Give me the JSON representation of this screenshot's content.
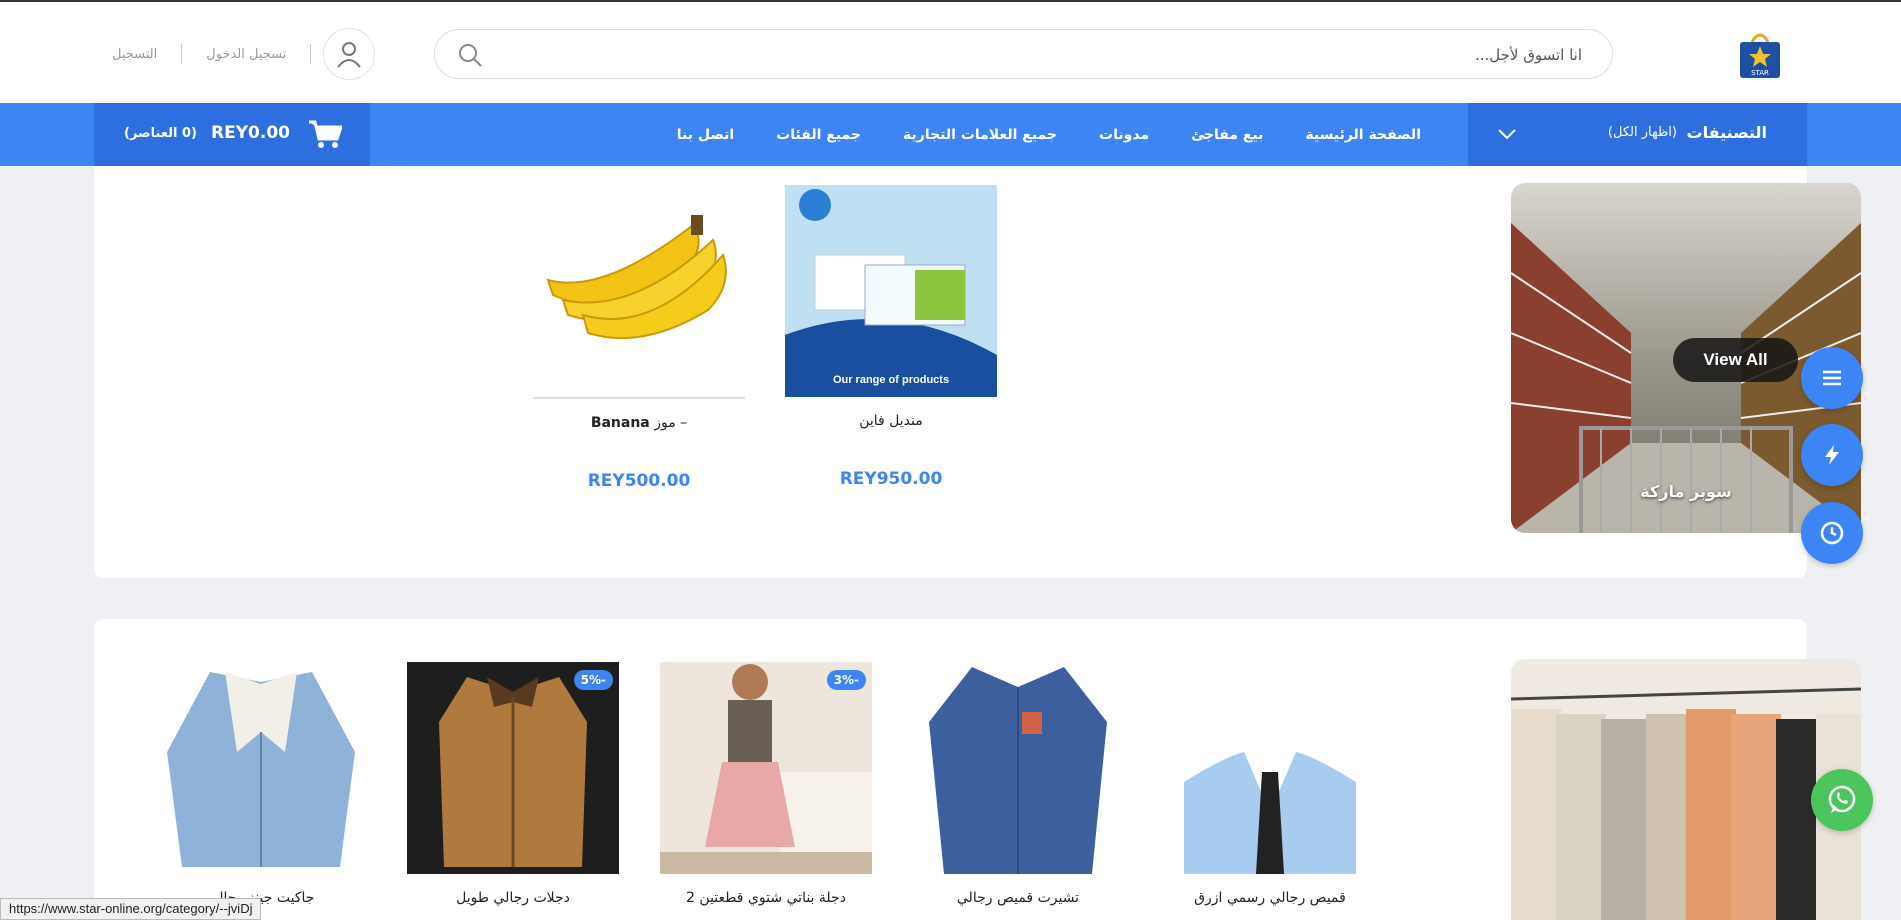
{
  "header": {
    "search_placeholder": "انا اتسوق لأجل...",
    "login_label": "تسجيل الدخول",
    "register_label": "التسجيل"
  },
  "nav": {
    "categories_title": "التصنيفات",
    "show_all": "(اظهار الكل)",
    "links": [
      "الصفحة الرئيسية",
      "بيع مفاجئ",
      "مدونات",
      "جميع العلامات التجارية",
      "جميع الفئات",
      "اتصل بنا"
    ],
    "cart_total": "REY0.00",
    "cart_items": "(0 العناصر)"
  },
  "section1": {
    "banner_title": "سوبر ماركة",
    "view_all": "View All",
    "products": [
      {
        "name": "منديل فاين",
        "price": "REY950.00"
      },
      {
        "name_ar": "موز –",
        "name_en": "Banana",
        "price": "REY500.00"
      }
    ]
  },
  "section2": {
    "products": [
      {
        "name": "قميص رجالي رسمي ازرق",
        "badge": ""
      },
      {
        "name": "تشيرت قميص رجالي",
        "badge": ""
      },
      {
        "name": "دجلة بناتي شتوي قطعتين 2",
        "badge": "3%-"
      },
      {
        "name": "دجلات رجالي طويل",
        "badge": "5%-"
      },
      {
        "name": "جاكيت جينز رجالي",
        "badge": ""
      }
    ]
  },
  "status_bar": {
    "url": "https://www.star-online.org/category/--jviDj"
  },
  "colors": {
    "primary": "#3d85f5",
    "primary_dark": "#2e6fe0",
    "whatsapp": "#4cc65c"
  }
}
